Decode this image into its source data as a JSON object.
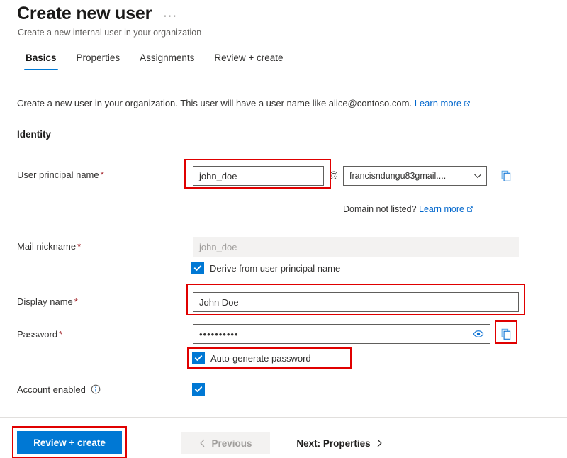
{
  "header": {
    "title": "Create new user",
    "subtitle": "Create a new internal user in your organization",
    "more_menu": "···"
  },
  "tabs": [
    {
      "label": "Basics",
      "active": true
    },
    {
      "label": "Properties",
      "active": false
    },
    {
      "label": "Assignments",
      "active": false
    },
    {
      "label": "Review + create",
      "active": false
    }
  ],
  "intro": {
    "text": "Create a new user in your organization. This user will have a user name like alice@contoso.com.",
    "link": "Learn more"
  },
  "identity": {
    "heading": "Identity",
    "upn": {
      "label": "User principal name",
      "required": "*",
      "value": "john_doe",
      "at": "@",
      "domain_value": "francisndungu83gmail....",
      "copy_icon": "copy-icon",
      "hint_text": "Domain not listed?",
      "hint_link": "Learn more"
    },
    "mail_nickname": {
      "label": "Mail nickname",
      "required": "*",
      "value": "john_doe",
      "checkbox_label": "Derive from user principal name",
      "checked": true
    },
    "display_name": {
      "label": "Display name",
      "required": "*",
      "value": "John Doe"
    },
    "password": {
      "label": "Password",
      "required": "*",
      "value": "••••••••••",
      "reveal_icon": "eye-icon",
      "copy_icon": "copy-icon",
      "checkbox_label": "Auto-generate password",
      "checked": true
    },
    "account_enabled": {
      "label": "Account enabled",
      "info_icon": "info-icon",
      "checked": true
    }
  },
  "footer": {
    "review_create": "Review + create",
    "previous": "Previous",
    "next": "Next: Properties"
  },
  "colors": {
    "accent": "#0078d4",
    "link": "#0066cc",
    "required": "#a4262c",
    "annotation": "#e00000",
    "border": "#605e5c",
    "disabled_bg": "#f3f2f1"
  }
}
